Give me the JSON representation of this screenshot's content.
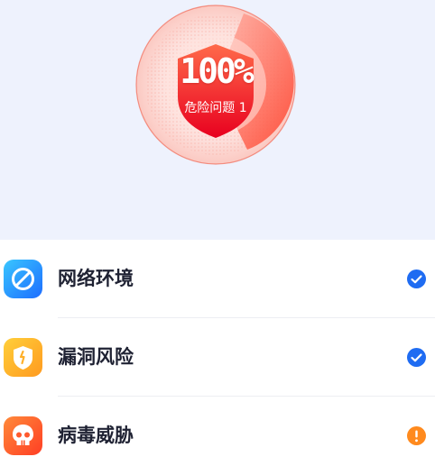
{
  "scan": {
    "percent": "100%",
    "danger_label": "危险问题",
    "danger_count": "1",
    "progress": 1.0
  },
  "items": [
    {
      "label": "网络环境",
      "icon": "network-icon",
      "status": "ok",
      "color": "#2e7dfa"
    },
    {
      "label": "漏洞风险",
      "icon": "shield-icon",
      "status": "ok",
      "color": "#ffad2a"
    },
    {
      "label": "病毒威胁",
      "icon": "skull-icon",
      "status": "warning",
      "color": "#ff5a2e"
    }
  ],
  "colors": {
    "header_bg": "#eef2fd",
    "ok": "#1f6cf2",
    "warning": "#ff8a1e"
  }
}
